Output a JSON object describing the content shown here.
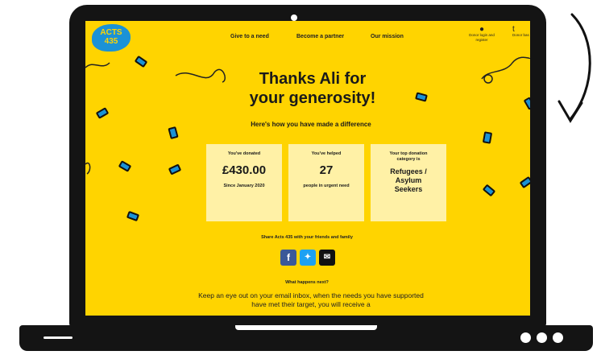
{
  "logo": {
    "line1": "ACTS",
    "line2": "435"
  },
  "nav": {
    "give": "Give to a need",
    "partner": "Become a partner",
    "mission": "Our mission",
    "donor_login": "Donor login and register",
    "donor_basket": "Donor bas"
  },
  "hero": {
    "title_line1": "Thanks Ali for",
    "title_line2": "your generosity!",
    "subtitle": "Here's how you have made a difference"
  },
  "cards": [
    {
      "label": "You've donated",
      "value": "£430.00",
      "footer": "Since January 2020"
    },
    {
      "label": "You've helped",
      "value": "27",
      "footer": "people in urgent need"
    },
    {
      "label": "Your top donation category is",
      "value": "Refugees / Asylum Seekers"
    }
  ],
  "share": {
    "text": "Share Acts 435 with your friends and family",
    "icons": [
      "facebook-icon",
      "twitter-icon",
      "email-icon"
    ]
  },
  "next": {
    "heading": "What happens next?",
    "body": "Keep an eye out on your email inbox, when the needs you have supported have met their target, you will receive a"
  },
  "colors": {
    "background": "#FFD400",
    "accent": "#1B92D6",
    "card": "#FFF1A6",
    "frame": "#141414"
  }
}
